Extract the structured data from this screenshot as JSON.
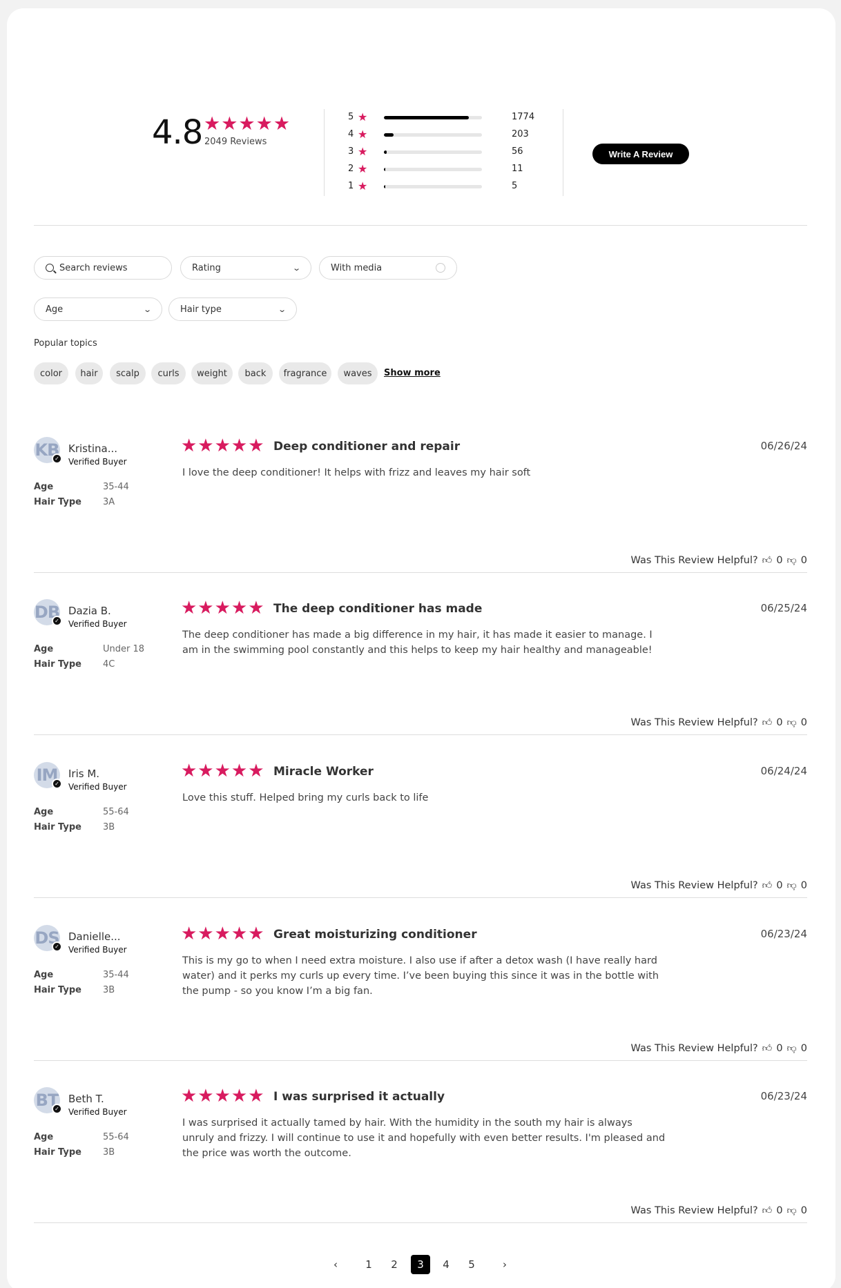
{
  "summary": {
    "average": "4.8",
    "stars": "★★★★★",
    "review_count": "2049 Reviews",
    "histogram": [
      {
        "label": "5",
        "count": "1774",
        "fraction": 0.866
      },
      {
        "label": "4",
        "count": "203",
        "fraction": 0.099
      },
      {
        "label": "3",
        "count": "56",
        "fraction": 0.027
      },
      {
        "label": "2",
        "count": "11",
        "fraction": 0.005
      },
      {
        "label": "1",
        "count": "5",
        "fraction": 0.002
      }
    ],
    "write_review": "Write A Review"
  },
  "filters": {
    "search_placeholder": "Search reviews",
    "rating": "Rating",
    "with_media": "With media",
    "age": "Age",
    "hair_type": "Hair type",
    "popular_topics_label": "Popular topics",
    "topics": [
      "color",
      "hair",
      "scalp",
      "curls",
      "weight",
      "back",
      "fragrance",
      "waves"
    ],
    "show_more": "Show more"
  },
  "reviews": [
    {
      "initials": "KB",
      "name": "Kristina...",
      "verified": "Verified Buyer",
      "age_label": "Age",
      "age": "35-44",
      "hair_label": "Hair Type",
      "hair": "3A",
      "stars": "★★★★★",
      "title": "Deep conditioner and repair",
      "date": "06/26/24",
      "body": "I love the deep conditioner! It helps with frizz and leaves my hair soft",
      "helpful_label": "Was This Review Helpful?",
      "up": "0",
      "down": "0"
    },
    {
      "initials": "DB",
      "name": "Dazia B.",
      "verified": "Verified Buyer",
      "age_label": "Age",
      "age": "Under 18",
      "hair_label": "Hair Type",
      "hair": "4C",
      "stars": "★★★★★",
      "title": "The deep conditioner has made",
      "date": "06/25/24",
      "body": "The deep conditioner has made a big difference in my hair, it has made it easier to manage. I am in the swimming pool constantly and this helps to keep my hair healthy and manageable!",
      "helpful_label": "Was This Review Helpful?",
      "up": "0",
      "down": "0"
    },
    {
      "initials": "IM",
      "name": "Iris M.",
      "verified": "Verified Buyer",
      "age_label": "Age",
      "age": "55-64",
      "hair_label": "Hair Type",
      "hair": "3B",
      "stars": "★★★★★",
      "title": "Miracle Worker",
      "date": "06/24/24",
      "body": "Love this stuff. Helped bring my curls back to life",
      "helpful_label": "Was This Review Helpful?",
      "up": "0",
      "down": "0"
    },
    {
      "initials": "DS",
      "name": "Danielle...",
      "verified": "Verified Buyer",
      "age_label": "Age",
      "age": "35-44",
      "hair_label": "Hair Type",
      "hair": "3B",
      "stars": "★★★★★",
      "title": "Great moisturizing conditioner",
      "date": "06/23/24",
      "body": "This is my go to when I need extra moisture. I also use if after a detox wash (I have really hard water) and it perks my curls up every time. I’ve been buying this since it was in the bottle with the pump - so you know I’m a big fan.",
      "helpful_label": "Was This Review Helpful?",
      "up": "0",
      "down": "0"
    },
    {
      "initials": "BT",
      "name": "Beth T.",
      "verified": "Verified Buyer",
      "age_label": "Age",
      "age": "55-64",
      "hair_label": "Hair Type",
      "hair": "3B",
      "stars": "★★★★★",
      "title": "I was surprised it actually",
      "date": "06/23/24",
      "body": "I was surprised it actually tamed by hair. With the humidity in the south my hair is always unruly and frizzy. I will continue to use it and hopefully with even better results. I'm pleased and the price was worth the outcome.",
      "helpful_label": "Was This Review Helpful?",
      "up": "0",
      "down": "0"
    }
  ],
  "pagination": {
    "prev": "‹",
    "pages": [
      "1",
      "2",
      "3",
      "4",
      "5"
    ],
    "current": "3",
    "next": "›"
  },
  "colors": {
    "star": "#d81b5f",
    "accent": "#000000"
  }
}
